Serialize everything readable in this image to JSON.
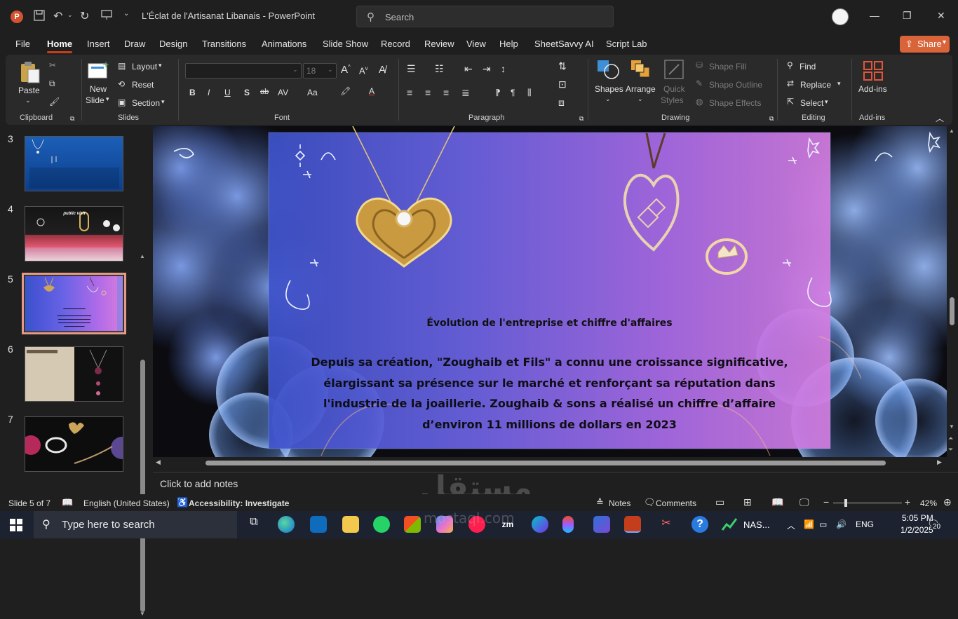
{
  "app": {
    "doc_title": "L'Éclat de l'Artisanat Libanais  -  PowerPoint",
    "search_placeholder": "Search"
  },
  "menu": {
    "tabs": [
      "File",
      "Home",
      "Insert",
      "Draw",
      "Design",
      "Transitions",
      "Animations",
      "Slide Show",
      "Record",
      "Review",
      "View",
      "Help",
      "SheetSavvy AI",
      "Script Lab"
    ],
    "active": "Home",
    "share_label": "Share"
  },
  "ribbon": {
    "clipboard": {
      "label": "Clipboard",
      "paste": "Paste"
    },
    "slides": {
      "label": "Slides",
      "new_slide": "New",
      "new_slide_2": "Slide",
      "layout": "Layout",
      "reset": "Reset",
      "section": "Section"
    },
    "font": {
      "label": "Font",
      "font_name": "",
      "font_size": "18"
    },
    "paragraph": {
      "label": "Paragraph"
    },
    "drawing": {
      "label": "Drawing",
      "shapes": "Shapes",
      "arrange": "Arrange",
      "quick_styles": "Quick",
      "quick_styles_2": "Styles",
      "shape_fill": "Shape Fill",
      "shape_outline": "Shape Outline",
      "shape_effects": "Shape Effects"
    },
    "editing": {
      "label": "Editing",
      "find": "Find",
      "replace": "Replace",
      "select": "Select"
    },
    "addins": {
      "label": "Add-ins",
      "addins_btn": "Add-ins"
    }
  },
  "thumbnails": [
    {
      "num": "3"
    },
    {
      "num": "4",
      "caption": "public visit"
    },
    {
      "num": "5",
      "selected": true
    },
    {
      "num": "6"
    },
    {
      "num": "7"
    }
  ],
  "slide": {
    "title": "Évolution de l'entreprise et chiffre d'affaires",
    "body_lines": [
      "Depuis sa création, \"Zoughaib et Fils\" a connu une croissance significative,",
      "élargissant sa présence sur le marché et renforçant sa réputation dans",
      "l'industrie de la joaillerie. Zoughaib & sons a réalisé un chiffre d’affaire",
      "d’environ 11 millions de dollars en 2023"
    ]
  },
  "notes": {
    "placeholder": "Click to add notes"
  },
  "status": {
    "slide_pos": "Slide 5 of 7",
    "language": "English (United States)",
    "accessibility": "Accessibility: Investigate",
    "notes_btn": "Notes",
    "comments_btn": "Comments",
    "zoom": "42%"
  },
  "taskbar": {
    "search_placeholder": "Type here to search",
    "nas_label": "NAS...",
    "lang": "ENG",
    "time": "5:05 PM",
    "date": "1/2/2025",
    "notif_count": "20"
  },
  "watermark": {
    "text": "مستقل",
    "sub": "mostaql.com"
  },
  "colors": {
    "accent": "#c43e1c",
    "share": "#d9643a"
  }
}
